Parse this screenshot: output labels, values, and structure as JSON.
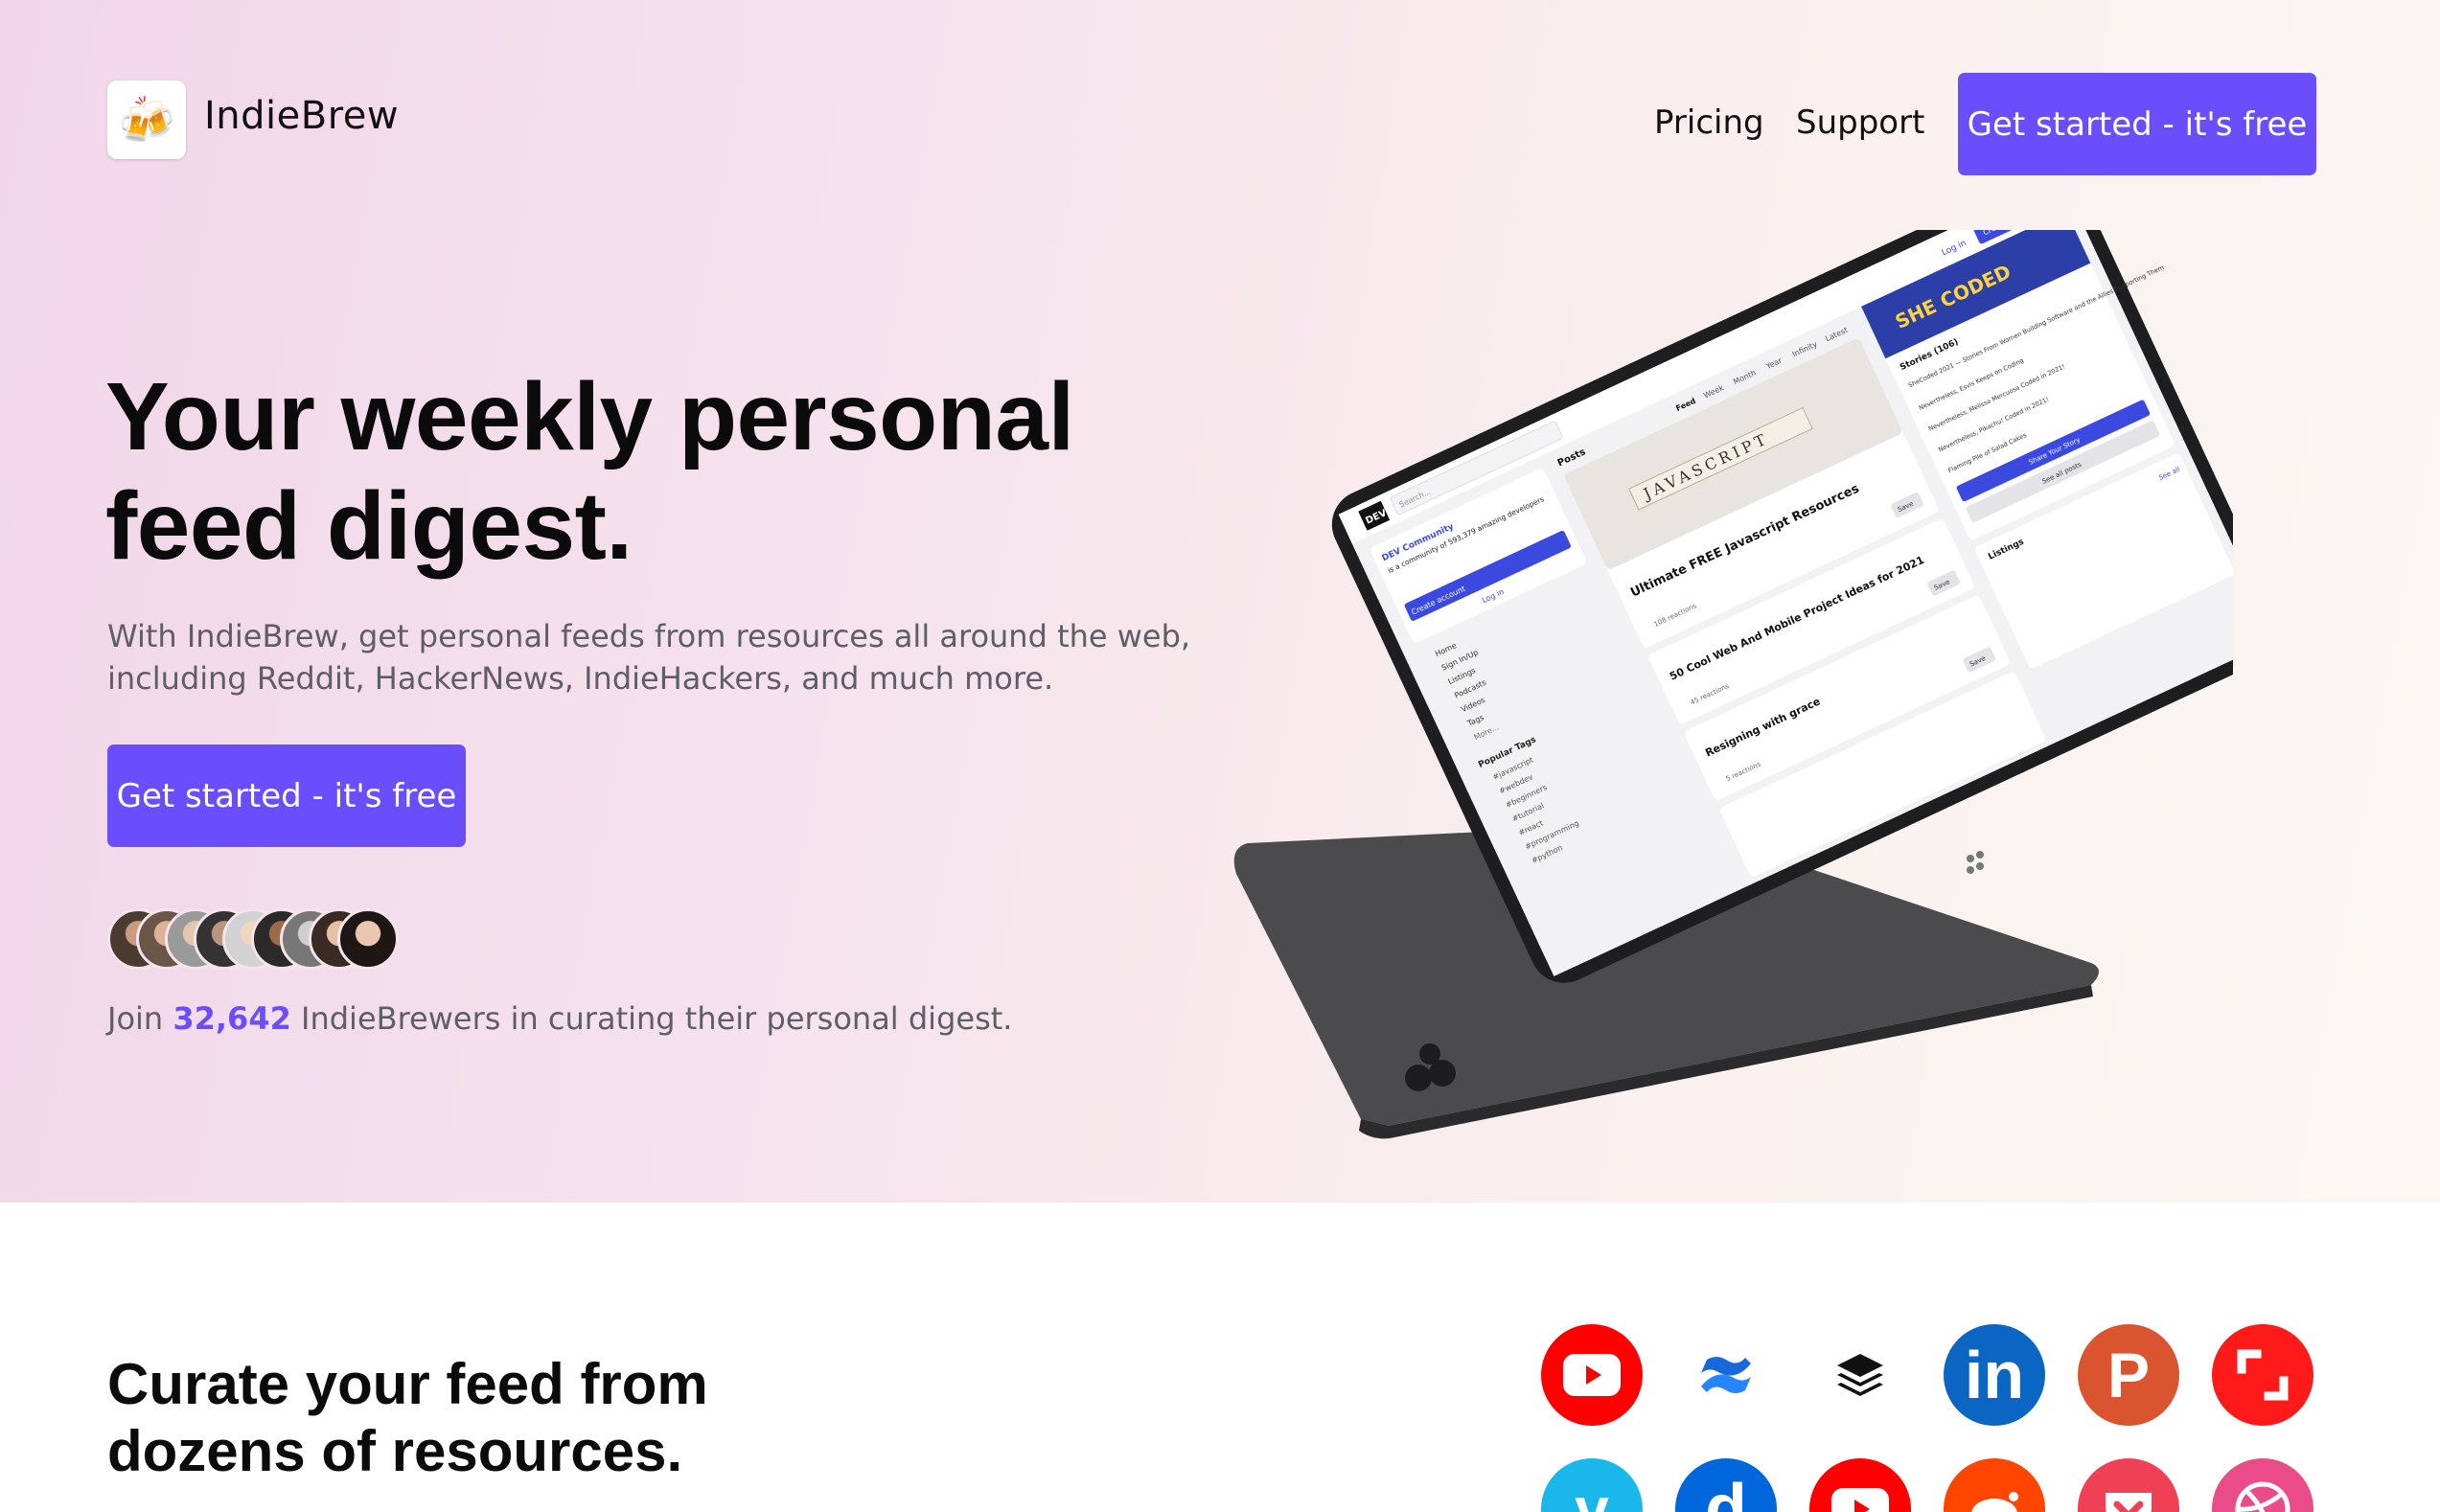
{
  "header": {
    "brand": "IndieBrew",
    "nav": [
      "Pricing",
      "Support"
    ],
    "cta": "Get started - it's free"
  },
  "hero": {
    "headline_line1": "Your weekly personal",
    "headline_line2": "feed digest.",
    "subtext_line1": "With IndieBrew, get personal feeds from resources all around the web,",
    "subtext_line2": "including Reddit, HackerNews, IndieHackers, and much more.",
    "cta": "Get started - it's free",
    "join_prefix": "Join",
    "join_count": "32,642",
    "join_suffix": "IndieBrewers in curating their personal digest."
  },
  "tablet_screen": {
    "logo": "DEV",
    "search": "Search...",
    "login": "Log in",
    "create": "Create account",
    "sidebar_intro_link": "DEV Community",
    "sidebar_intro": "is a community of 593,379 amazing developers",
    "sidebar_menu": [
      "Home",
      "Sign In/Up",
      "Listings",
      "Podcasts",
      "Videos",
      "Tags",
      "More..."
    ],
    "popular_tags_title": "Popular Tags",
    "popular_tags": [
      "#javascript",
      "#webdev",
      "#beginners",
      "#tutorial",
      "#react",
      "#programming",
      "#python"
    ],
    "posts_title": "Posts",
    "tabs": [
      "Feed",
      "Week",
      "Month",
      "Year",
      "Infinity",
      "Latest"
    ],
    "banner_word": "JAVASCRIPT",
    "posts": [
      {
        "title": "Ultimate FREE Javascript Resources",
        "meta": "108 reactions",
        "save": "Save"
      },
      {
        "title": "50 Cool Web And Mobile Project Ideas for 2021",
        "meta": "45 reactions",
        "save": "Save"
      },
      {
        "title": "Resigning with grace",
        "meta": "5 reactions",
        "save": "Save"
      }
    ],
    "stories_banner": "SHE CODED",
    "stories_title": "Stories (106)",
    "stories": [
      "SheCoded 2021 — Stories From Women Building Software and the Allies Supporting Them",
      "Nevertheless, Esvis Keeps on Coding",
      "Nevertheless, Melissa Mercuosa Coded in 2021!",
      "Nevertheless, Pikachu! Coded in 2021!",
      "Flaming Pile of Salad Cakes"
    ],
    "share_btn": "Share Your Story",
    "see_all": "See all posts",
    "listings_title": "Listings",
    "listings_see_all": "See all"
  },
  "resources": {
    "title_line1": "Curate your feed from",
    "title_line2": "dozens of resources.",
    "icons_row1": [
      {
        "name": "youtube-icon",
        "color": "#ff0000"
      },
      {
        "name": "confluence-icon",
        "color": "#2684ff"
      },
      {
        "name": "buffer-icon",
        "color": "#111111"
      },
      {
        "name": "linkedin-icon",
        "color": "#0a66c2"
      },
      {
        "name": "producthunt-icon",
        "color": "#da552f"
      },
      {
        "name": "screenshot-icon",
        "color": "#ff1a1a"
      }
    ],
    "icons_row2": [
      {
        "name": "vimeo-icon",
        "color": "#1ab7ea"
      },
      {
        "name": "dailymotion-icon",
        "color": "#0066dc"
      },
      {
        "name": "youtube-icon",
        "color": "#ff0000"
      },
      {
        "name": "reddit-icon",
        "color": "#ff4500"
      },
      {
        "name": "pocket-icon",
        "color": "#ef4056"
      },
      {
        "name": "dribbble-icon",
        "color": "#ea4c89"
      }
    ],
    "icon_text": {
      "linkedin": "in",
      "producthunt": "P",
      "dailymotion": "d"
    }
  },
  "colors": {
    "accent": "#6a4dfb",
    "text": "#0b0b0b",
    "muted": "#5e5e66"
  }
}
